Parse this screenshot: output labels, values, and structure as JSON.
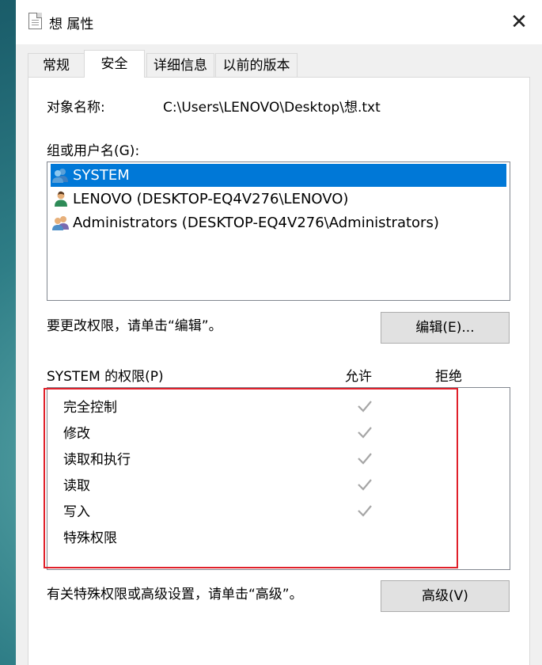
{
  "window": {
    "title": "想 属性",
    "close_glyph": "✕"
  },
  "tabs": [
    {
      "label": "常规",
      "active": false
    },
    {
      "label": "安全",
      "active": true
    },
    {
      "label": "详细信息",
      "active": false
    },
    {
      "label": "以前的版本",
      "active": false
    }
  ],
  "security": {
    "object_name_label": "对象名称:",
    "object_name_value": "C:\\Users\\LENOVO\\Desktop\\想.txt",
    "groups_label": "组或用户名(G):",
    "groups": [
      {
        "name": "SYSTEM",
        "icon": "group-users-icon",
        "selected": true
      },
      {
        "name": "LENOVO (DESKTOP-EQ4V276\\LENOVO)",
        "icon": "user-icon",
        "selected": false
      },
      {
        "name": "Administrators (DESKTOP-EQ4V276\\Administrators)",
        "icon": "group-users-icon",
        "selected": false
      }
    ],
    "edit_hint": "要更改权限，请单击“编辑”。",
    "edit_button": "编辑(E)...",
    "permissions_label": "SYSTEM 的权限(P)",
    "allow_header": "允许",
    "deny_header": "拒绝",
    "permissions": [
      {
        "name": "完全控制",
        "allow": true,
        "deny": false
      },
      {
        "name": "修改",
        "allow": true,
        "deny": false
      },
      {
        "name": "读取和执行",
        "allow": true,
        "deny": false
      },
      {
        "name": "读取",
        "allow": true,
        "deny": false
      },
      {
        "name": "写入",
        "allow": true,
        "deny": false
      },
      {
        "name": "特殊权限",
        "allow": false,
        "deny": false
      }
    ],
    "advanced_hint": "有关特殊权限或高级设置，请单击“高级”。",
    "advanced_button": "高级(V)"
  },
  "colors": {
    "selection": "#0078d7",
    "highlight_border": "#e0202a",
    "check_gray": "#a6a6a6"
  }
}
